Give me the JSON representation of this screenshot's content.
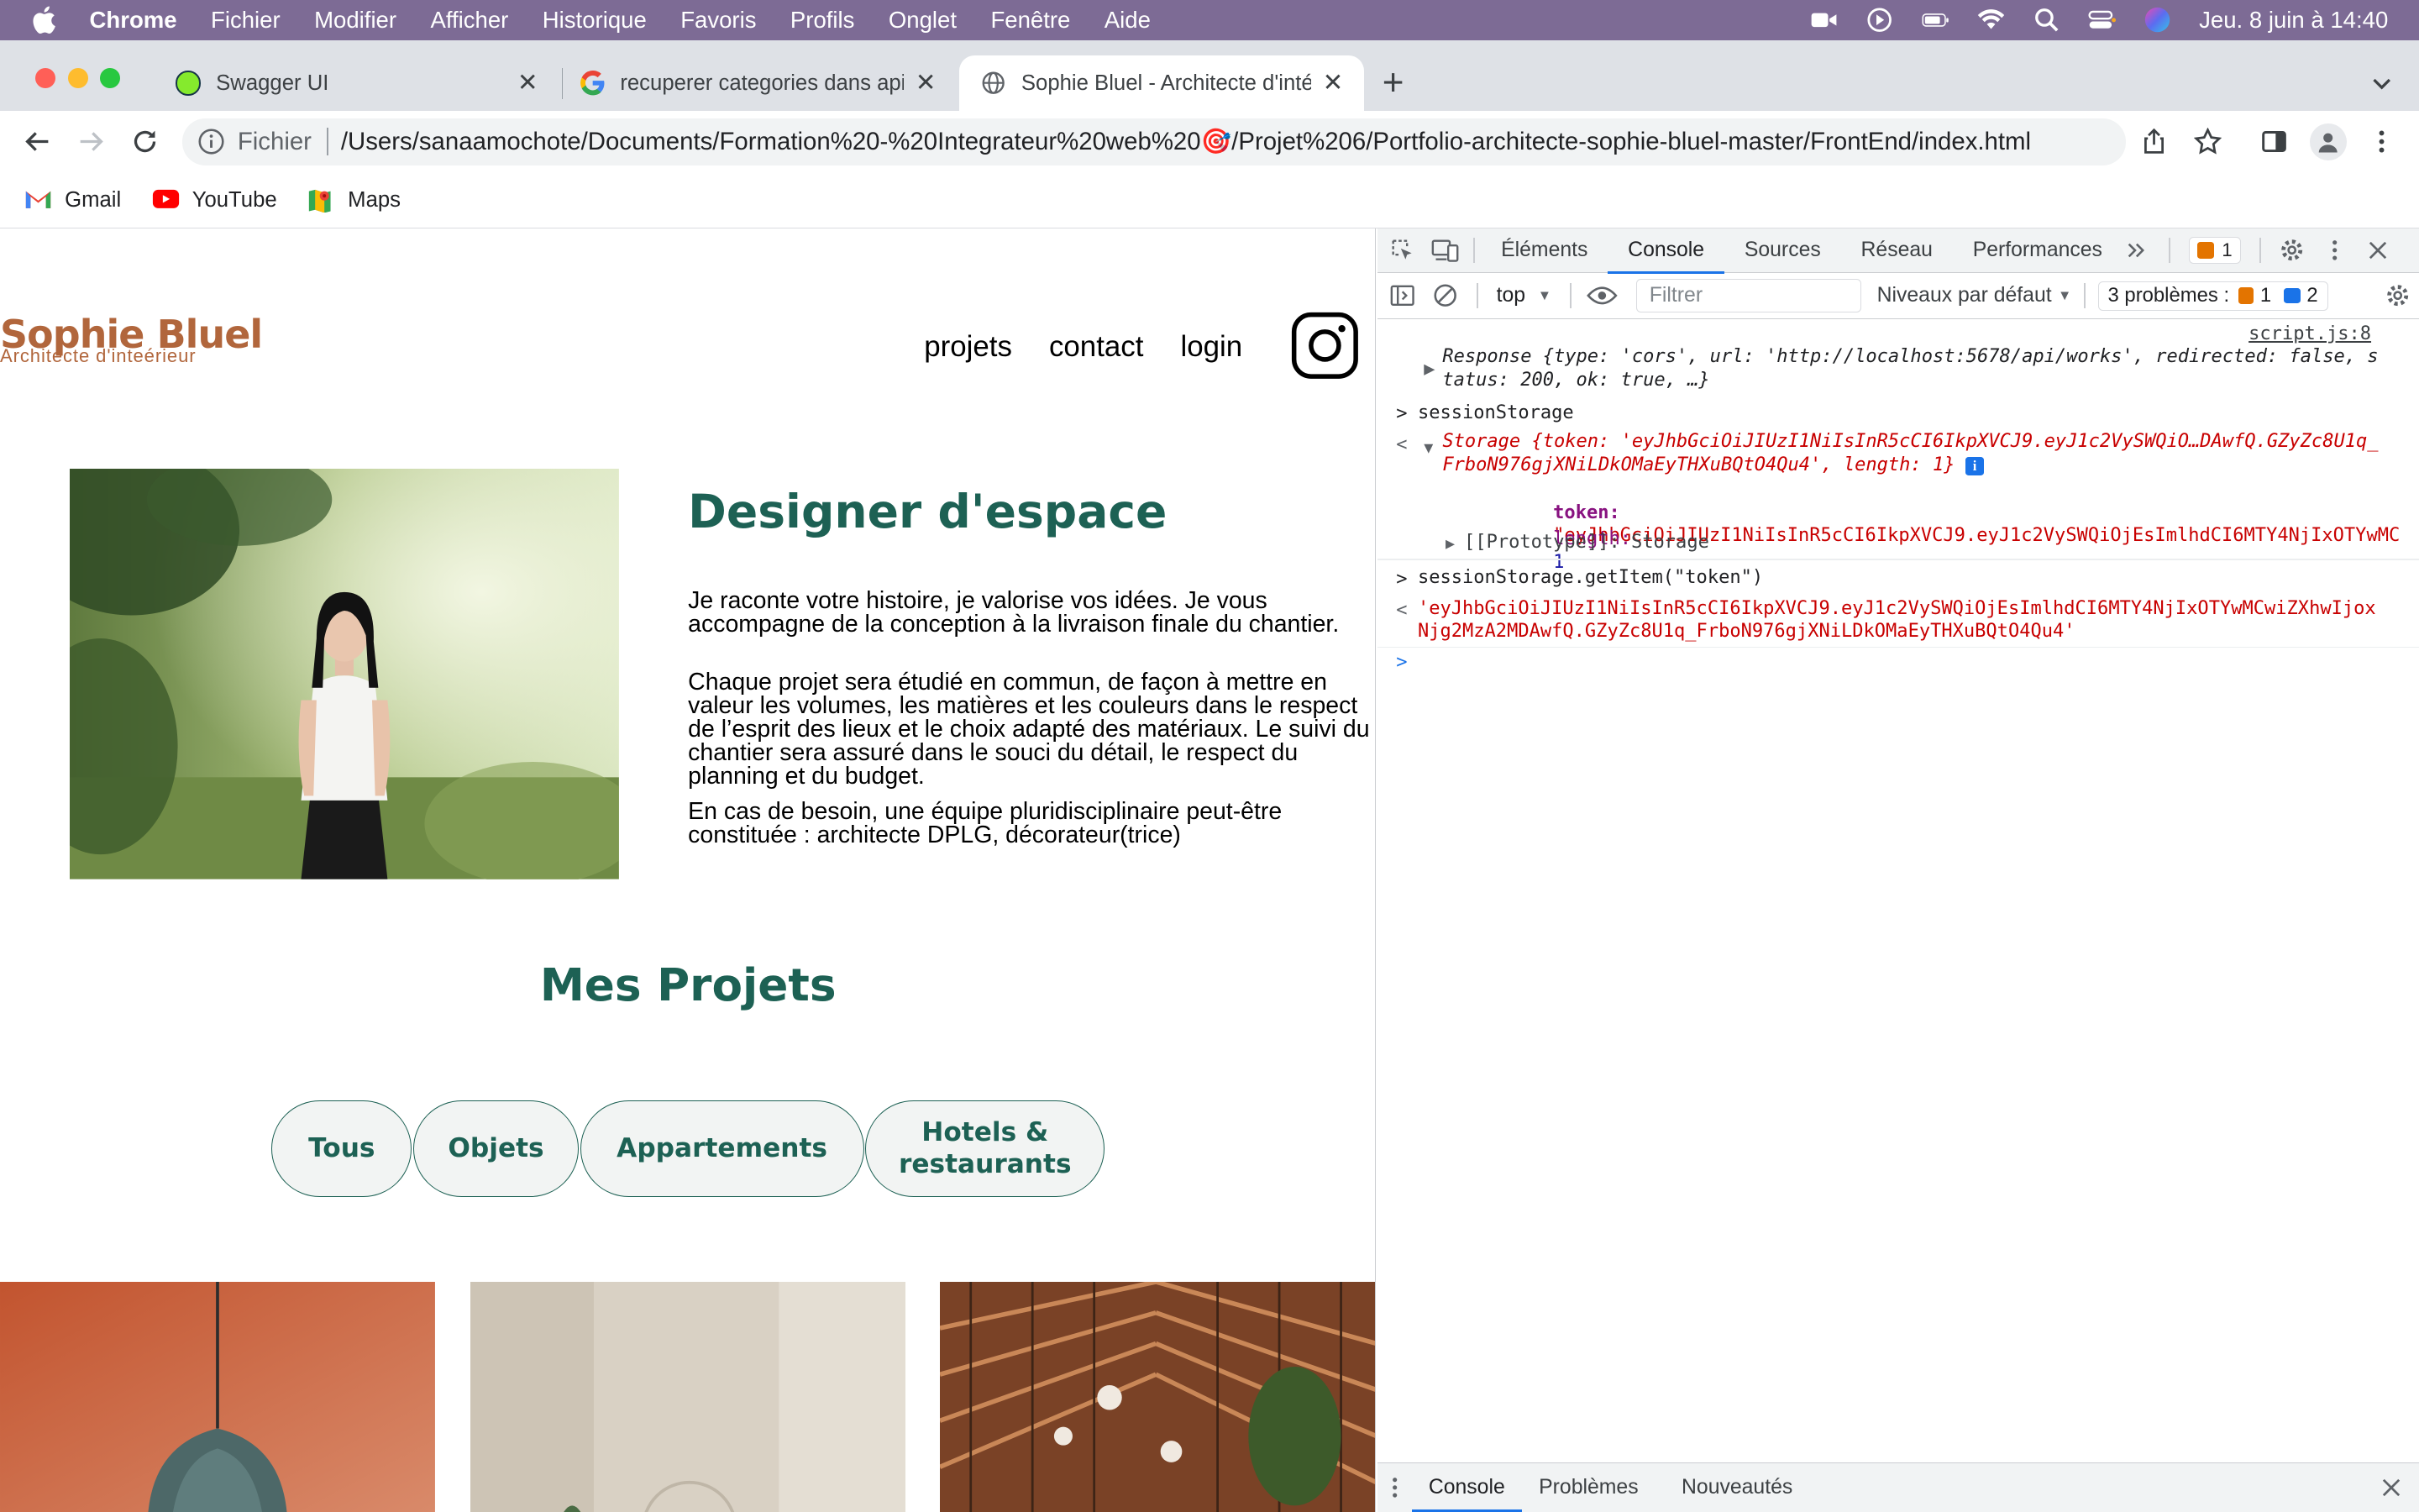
{
  "menubar": {
    "app": "Chrome",
    "items": [
      "Fichier",
      "Modifier",
      "Afficher",
      "Historique",
      "Favoris",
      "Profils",
      "Onglet",
      "Fenêtre",
      "Aide"
    ],
    "clock": "Jeu. 8 juin à 14:40",
    "background_color": "#7d6b95"
  },
  "tabs": [
    {
      "title": "Swagger UI",
      "icon": "swagger-icon"
    },
    {
      "title": "recuperer categories dans api -",
      "icon": "google-icon"
    },
    {
      "title": "Sophie Bluel - Architecte d'inté",
      "icon": "globe-icon",
      "active": true
    }
  ],
  "new_tab_label": "+",
  "addressbar": {
    "scheme": "Fichier",
    "url": "/Users/sanaamochote/Documents/Formation%20-%20Integrateur%20web%20🎯/Projet%206/Portfolio-architecte-sophie-bluel-master/FrontEnd/index.html"
  },
  "bookmarks": [
    {
      "label": "Gmail",
      "icon": "gmail-icon"
    },
    {
      "label": "YouTube",
      "icon": "youtube-icon"
    },
    {
      "label": "Maps",
      "icon": "maps-icon"
    }
  ],
  "site": {
    "logo": "Sophie Bluel",
    "logo_sub": "Architecte d'inteérieur",
    "nav": [
      "projets",
      "contact",
      "login"
    ],
    "headline": "Designer d'espace",
    "paragraphs": [
      "Je raconte votre histoire, je valorise vos idées. Je vous accompagne de la conception à la livraison finale du chantier.",
      "Chaque projet sera étudié en commun, de façon à mettre en valeur les volumes, les matières et les couleurs dans le respect de l’esprit des lieux et le choix adapté des matériaux. Le suivi du chantier sera assuré dans le souci du détail, le respect du planning et du budget.",
      "En cas de besoin, une équipe pluridisciplinaire peut-être constituée : architecte DPLG, décorateur(trice)"
    ],
    "projects_title": "Mes Projets",
    "filters": [
      "Tous",
      "Objets",
      "Appartements",
      "Hotels & restaurants"
    ],
    "brand_color": "#1d6154",
    "logo_color": "#b1663c"
  },
  "devtools": {
    "tabs": [
      "Éléments",
      "Console",
      "Sources",
      "Réseau",
      "Performances"
    ],
    "active_tab": "Console",
    "warning_badge": "1",
    "context": "top",
    "filter_placeholder": "Filtrer",
    "levels": "Niveaux par défaut",
    "problems_label": "3 problèmes :",
    "problems_warn": "1",
    "problems_info": "2",
    "source_link": "script.js:8",
    "console": {
      "response_line1": "Response {type: 'cors', url: 'http://localhost:5678/api/works', redirected: false, s",
      "response_line2": "tatus: 200, ok: true, …}",
      "cmd1": "sessionStorage",
      "storage_line1": "Storage {token: 'eyJhbGciOiJIUzI1NiIsInR5cCI6IkpXVCJ9.eyJ1c2VySWQiO…DAwfQ.GZyZc8U1q_",
      "storage_line2": "FrboN976gjXNiLDkOMaEyTHXuBQtO4Qu4', length: 1}",
      "token_key": "token:",
      "token_value": "\"eyJhbGciOiJIUzI1NiIsInR5cCI6IkpXVCJ9.eyJ1c2VySWQiOjEsImlhdCI6MTY4NjIxOTYwMC",
      "length_key": "length:",
      "length_value": "1",
      "prototype": "[[Prototype]]: Storage",
      "cmd2": "sessionStorage.getItem(\"token\")",
      "result_line1": "'eyJhbGciOiJIUzI1NiIsInR5cCI6IkpXVCJ9.eyJ1c2VySWQiOjEsImlhdCI6MTY4NjIxOTYwMCwiZXhwIjox",
      "result_line2": "Njg2MzA2MDAwfQ.GZyZc8U1q_FrboN976gjXNiLDkOMaEyTHXuBQtO4Qu4'"
    },
    "drawer_tabs": [
      "Console",
      "Problèmes",
      "Nouveautés"
    ]
  }
}
